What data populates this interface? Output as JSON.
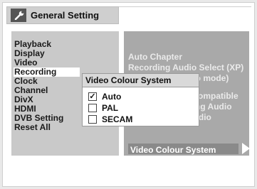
{
  "title": "General Setting",
  "left_menu": {
    "items": [
      {
        "label": "Playback"
      },
      {
        "label": "Display"
      },
      {
        "label": "Video"
      },
      {
        "label": "Recording"
      },
      {
        "label": "Clock"
      },
      {
        "label": "Channel"
      },
      {
        "label": "DivX"
      },
      {
        "label": "HDMI"
      },
      {
        "label": "DVB Setting"
      },
      {
        "label": "Reset All"
      }
    ],
    "selected": "Recording"
  },
  "right_menu": {
    "items": [
      {
        "label": "Auto Chapter"
      },
      {
        "label": "Recording Audio Select (XP)"
      },
      {
        "label": "eo mode)"
      },
      {
        "label": "ompatible"
      },
      {
        "label": "ng Audio"
      },
      {
        "label": "External Input Audio"
      },
      {
        "label": "Video Colour System"
      }
    ],
    "selected": "Video Colour System"
  },
  "popup": {
    "title": "Video Colour System",
    "options": [
      {
        "label": "Auto",
        "checked": true
      },
      {
        "label": "PAL",
        "checked": false
      },
      {
        "label": "SECAM",
        "checked": false
      }
    ],
    "check_glyph": "✓",
    "selected": "Auto"
  },
  "colors": {
    "left_panel": "#c9c9c9",
    "right_panel": "#a9a9a9",
    "highlight": "#ffffff"
  }
}
